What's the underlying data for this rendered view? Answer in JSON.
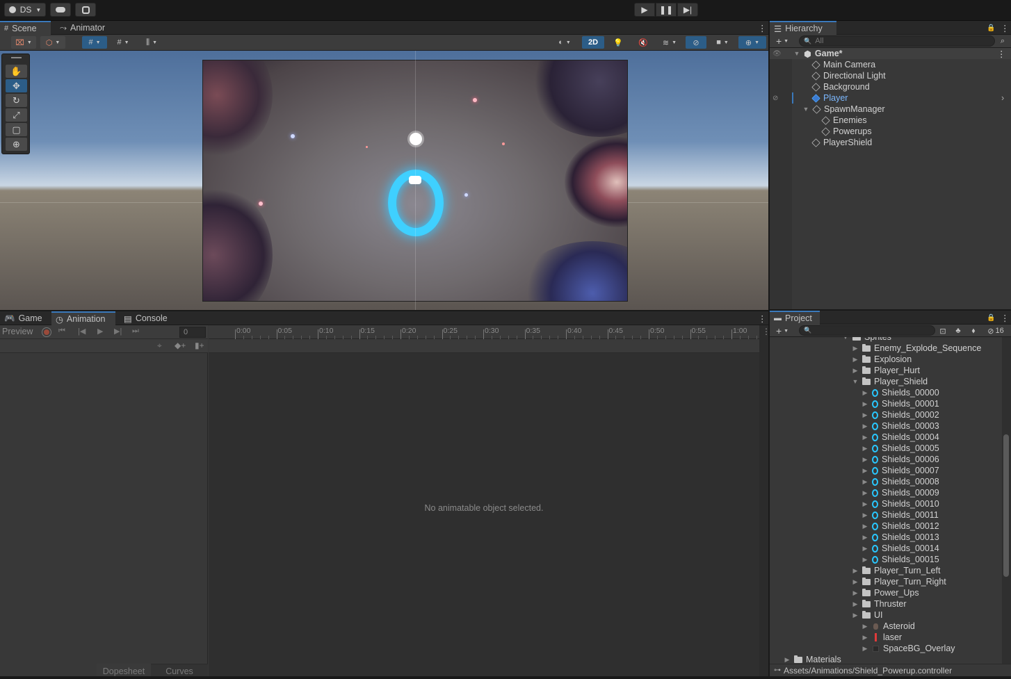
{
  "topbar": {
    "account_label": "DS"
  },
  "scene_panel": {
    "tabs": [
      {
        "label": "Scene"
      },
      {
        "label": "Animator"
      }
    ],
    "toolbar": {
      "mode_2d_label": "2D"
    }
  },
  "hierarchy": {
    "tab_label": "Hierarchy",
    "search_placeholder": "All",
    "scene_name": "Game*",
    "items": [
      {
        "label": "Main Camera"
      },
      {
        "label": "Directional Light"
      },
      {
        "label": "Background"
      },
      {
        "label": "Player"
      },
      {
        "label": "SpawnManager"
      },
      {
        "label": "Enemies"
      },
      {
        "label": "Powerups"
      },
      {
        "label": "PlayerShield"
      }
    ]
  },
  "bottom_panel": {
    "tabs": [
      {
        "label": "Game"
      },
      {
        "label": "Animation"
      },
      {
        "label": "Console"
      }
    ],
    "preview_label": "Preview",
    "frame_value": "0",
    "timeline_ticks": [
      "0:00",
      "0:05",
      "0:10",
      "0:15",
      "0:20",
      "0:25",
      "0:30",
      "0:35",
      "0:40",
      "0:45",
      "0:50",
      "0:55",
      "1:00"
    ],
    "empty_message": "No animatable object selected.",
    "dopesheet_label": "Dopesheet",
    "curves_label": "Curves"
  },
  "project": {
    "tab_label": "Project",
    "hidden_count": "16",
    "tree": [
      {
        "label": "Sprites",
        "type": "folder-open"
      },
      {
        "label": "Enemy_Explode_Sequence",
        "type": "folder"
      },
      {
        "label": "Explosion",
        "type": "folder"
      },
      {
        "label": "Player_Hurt",
        "type": "folder"
      },
      {
        "label": "Player_Shield",
        "type": "folder-open"
      },
      {
        "label": "Shields_00000",
        "type": "sprite"
      },
      {
        "label": "Shields_00001",
        "type": "sprite"
      },
      {
        "label": "Shields_00002",
        "type": "sprite"
      },
      {
        "label": "Shields_00003",
        "type": "sprite"
      },
      {
        "label": "Shields_00004",
        "type": "sprite"
      },
      {
        "label": "Shields_00005",
        "type": "sprite"
      },
      {
        "label": "Shields_00006",
        "type": "sprite"
      },
      {
        "label": "Shields_00007",
        "type": "sprite"
      },
      {
        "label": "Shields_00008",
        "type": "sprite"
      },
      {
        "label": "Shields_00009",
        "type": "sprite"
      },
      {
        "label": "Shields_00010",
        "type": "sprite"
      },
      {
        "label": "Shields_00011",
        "type": "sprite"
      },
      {
        "label": "Shields_00012",
        "type": "sprite"
      },
      {
        "label": "Shields_00013",
        "type": "sprite"
      },
      {
        "label": "Shields_00014",
        "type": "sprite"
      },
      {
        "label": "Shields_00015",
        "type": "sprite"
      },
      {
        "label": "Player_Turn_Left",
        "type": "folder"
      },
      {
        "label": "Player_Turn_Right",
        "type": "folder"
      },
      {
        "label": "Power_Ups",
        "type": "folder"
      },
      {
        "label": "Thruster",
        "type": "folder"
      },
      {
        "label": "UI",
        "type": "folder"
      },
      {
        "label": "Asteroid",
        "type": "sprite-asteroid"
      },
      {
        "label": "laser",
        "type": "sprite-laser"
      },
      {
        "label": "SpaceBG_Overlay",
        "type": "sprite-bg"
      },
      {
        "label": "Materials",
        "type": "folder"
      }
    ],
    "status_path": "Assets/Animations/Shield_Powerup.controller"
  }
}
